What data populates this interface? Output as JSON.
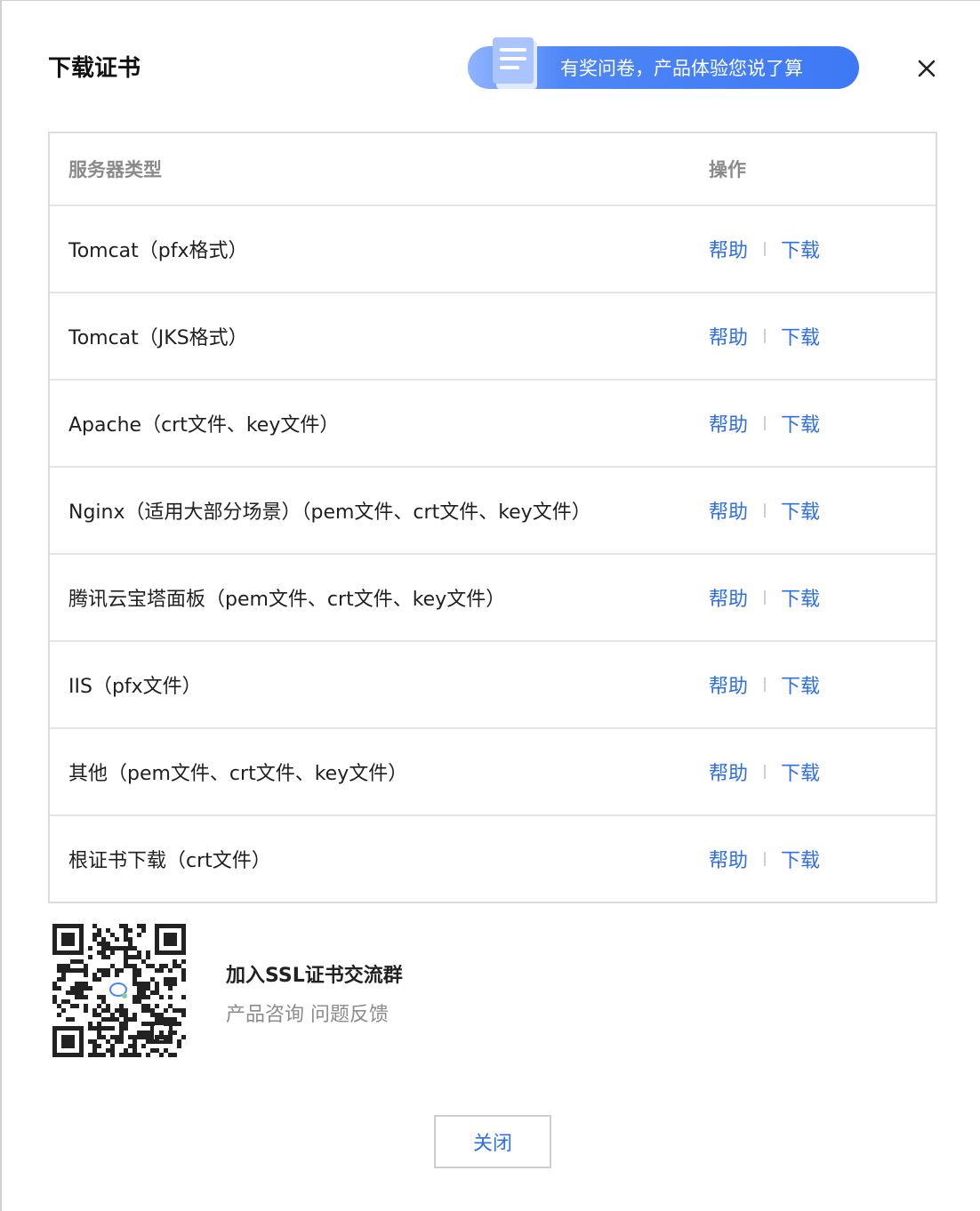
{
  "dialog": {
    "title": "下载证书",
    "survey_banner": "有奖问卷，产品体验您说了算",
    "close_button": "关闭"
  },
  "table": {
    "headers": {
      "type": "服务器类型",
      "action": "操作"
    },
    "action_labels": {
      "help": "帮助",
      "download": "下载"
    },
    "rows": [
      {
        "type": "Tomcat（pfx格式）"
      },
      {
        "type": "Tomcat（JKS格式）"
      },
      {
        "type": "Apache（crt文件、key文件）"
      },
      {
        "type": "Nginx（适用大部分场景）（pem文件、crt文件、key文件）"
      },
      {
        "type": "腾讯云宝塔面板（pem文件、crt文件、key文件）"
      },
      {
        "type": "IIS（pfx文件）"
      },
      {
        "type": "其他（pem文件、crt文件、key文件）"
      },
      {
        "type": "根证书下载（crt文件）"
      }
    ]
  },
  "community": {
    "title": "加入SSL证书交流群",
    "subtitle": "产品咨询 问题反馈"
  },
  "colors": {
    "link": "#2f6ee9",
    "banner": "#3e79f5"
  },
  "icons": [
    "survey-document-icon",
    "close-icon",
    "qr-code",
    "chat-icon"
  ]
}
